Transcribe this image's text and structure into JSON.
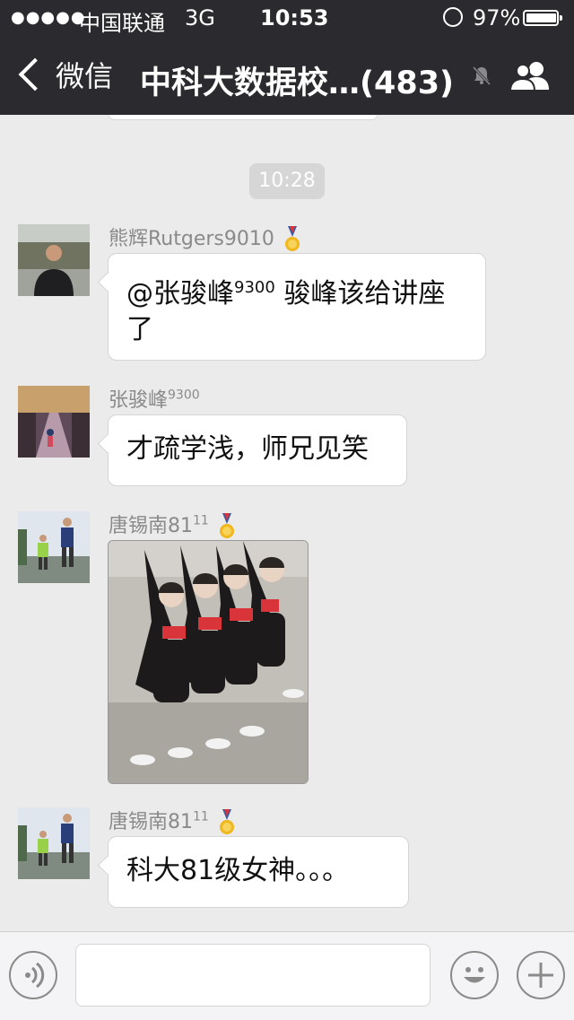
{
  "status_bar": {
    "signal": "●●●●●",
    "carrier": "中国联通",
    "network": "3G",
    "time": "10:53",
    "battery_percent": "97%",
    "battery_level": 0.97
  },
  "nav": {
    "back_label": "微信",
    "title": "中科大数据校…(483)",
    "icons": [
      "chevron-left-icon",
      "mute-bell-icon",
      "group-members-icon"
    ]
  },
  "chat": {
    "timestamp": "10:28",
    "messages": [
      {
        "sender_name": "熊辉Rutgers9010",
        "medal_icon": "medal-icon",
        "text_main": "@张骏峰",
        "text_sup": "9300",
        "text_rest": " 骏峰该给讲座了"
      },
      {
        "sender_name": "张骏峰",
        "sender_sup": "9300",
        "text": "才疏学浅，师兄见笑"
      },
      {
        "sender_name": "唐锡南81",
        "sender_sup": "11",
        "medal_icon": "medal-icon",
        "image": "photo of four dancers in black leotards posing on the ground"
      },
      {
        "sender_name": "唐锡南81",
        "sender_sup": "11",
        "medal_icon": "medal-icon",
        "text": "科大81级女神。。。"
      }
    ]
  },
  "input_bar": {
    "voice_icon": "voice-icon",
    "emoji_icon": "emoji-icon",
    "plus_icon": "plus-icon",
    "placeholder": ""
  },
  "colors": {
    "nav_bg": "#2b2b2f",
    "chat_bg": "#ebebeb",
    "bubble_bg": "#ffffff",
    "timestamp_bg": "#d6d6d6"
  }
}
